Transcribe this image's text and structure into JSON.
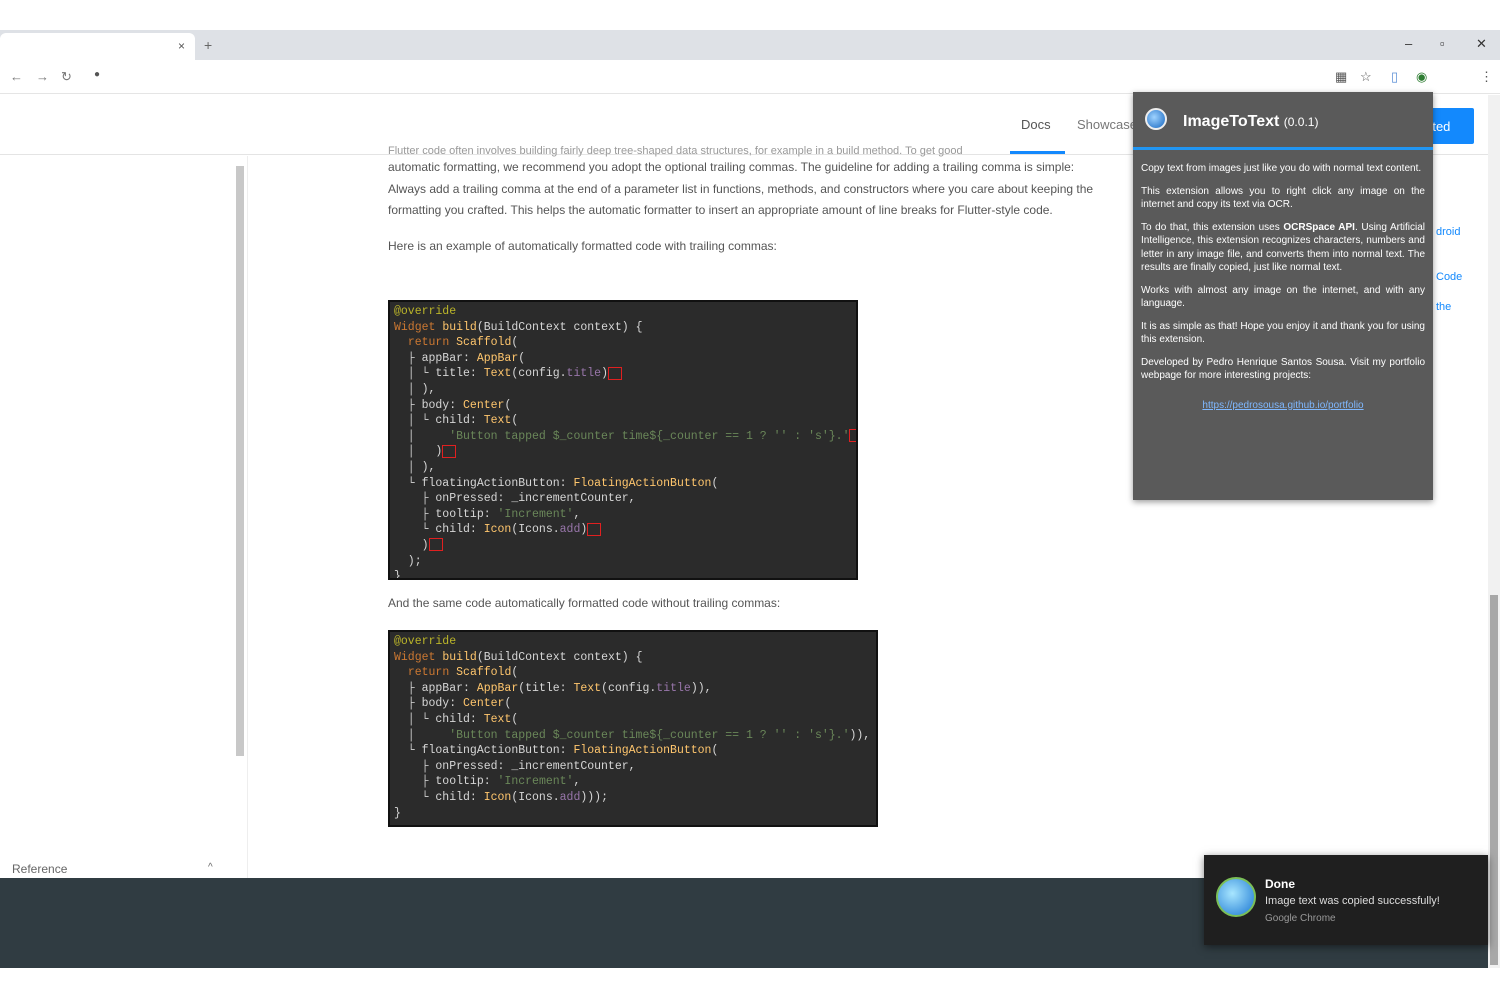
{
  "browser": {
    "tab_close": "×",
    "new_tab": "+",
    "win_minimize": "–",
    "win_maximize": "▫",
    "win_close": "✕",
    "nav_back": "←",
    "nav_forward": "→",
    "nav_reload": "↻",
    "menu": "⋮"
  },
  "header": {
    "docs": "Docs",
    "showcase": "Showcase",
    "get_started": "rted"
  },
  "sidebar": {
    "reference": "Reference",
    "chevron": "^"
  },
  "content": {
    "para_top_cut": "Flutter code often involves building fairly deep tree-shaped data structures, for example in a build method. To get good",
    "para1": "automatic formatting, we recommend you adopt the optional trailing commas. The guideline for adding a trailing comma is simple: Always add a trailing comma at the end of a parameter list in functions, methods, and constructors where you care about keeping the formatting you crafted. This helps the automatic formatter to insert an appropriate amount of line breaks for Flutter-style code.",
    "para2": "Here is an example of automatically formatted code with trailing commas:",
    "para3": "And the same code automatically formatted code without trailing commas:"
  },
  "popup": {
    "title": "ImageToText",
    "version": "(0.0.1)",
    "p1": "Copy text from images just like you do with normal text content.",
    "p2": "This extension allows you to right click any image on the internet and copy its text via OCR.",
    "p3_start": "To do that, this extension uses ",
    "p3_bold": "OCRSpace API",
    "p3_end": ". Using Artificial Intelligence, this extension recognizes characters, numbers and letter in any image file, and converts them into normal text. The results are finally copied, just like normal text.",
    "p4": "Works with almost any image on the internet, and with any language.",
    "p5": "It is as simple as that! Hope you enjoy it and thank you for using this extension.",
    "p6": "Developed by Pedro Henrique Santos Sousa. Visit my portfolio webpage for more interesting projects:",
    "link": "https://pedrosousa.github.io/portfolio"
  },
  "peeks": {
    "a": "droid",
    "b": "Code",
    "c": "the"
  },
  "toast": {
    "title": "Done",
    "message": "Image text was copied successfully!",
    "source": "Google Chrome"
  }
}
